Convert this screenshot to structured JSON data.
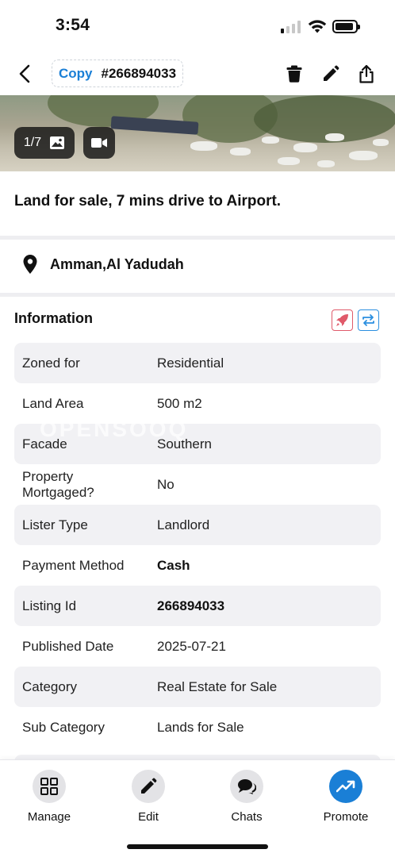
{
  "status_bar": {
    "time": "3:54"
  },
  "nav": {
    "copy_label": "Copy",
    "listing_ref": "#266894033"
  },
  "gallery": {
    "counter": "1/7"
  },
  "listing": {
    "title": "Land for sale, 7 mins drive to Airport."
  },
  "location": {
    "text": "Amman,Al Yadudah"
  },
  "information": {
    "heading": "Information",
    "rows": [
      {
        "key": "Zoned for",
        "value": "Residential"
      },
      {
        "key": "Land Area",
        "value": "500 m2"
      },
      {
        "key": "Facade",
        "value": "Southern"
      },
      {
        "key": "Property Mortgaged?",
        "value": "No"
      },
      {
        "key": "Lister Type",
        "value": "Landlord"
      },
      {
        "key": "Payment Method",
        "value": "Cash"
      },
      {
        "key": "Listing Id",
        "value": "266894033"
      },
      {
        "key": "Published Date",
        "value": "2025-07-21"
      },
      {
        "key": "Category",
        "value": "Real Estate for Sale"
      },
      {
        "key": "Sub Category",
        "value": "Lands for Sale"
      }
    ]
  },
  "watermark": "OPENSOOQ",
  "tabs": {
    "manage": "Manage",
    "edit": "Edit",
    "chats": "Chats",
    "promote": "Promote"
  },
  "colors": {
    "accent": "#1a7fd6",
    "row_shade": "#f1f1f4",
    "boost": "#e05a6a"
  }
}
